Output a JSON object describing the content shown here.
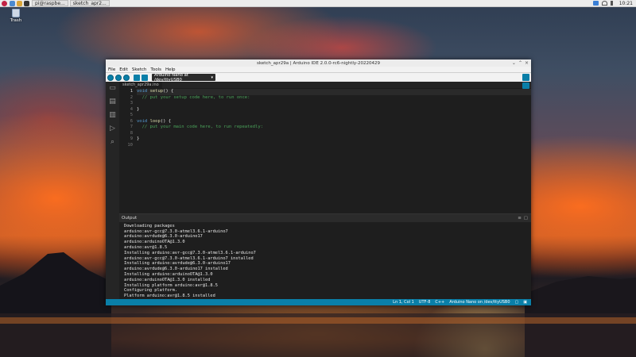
{
  "desktop": {
    "trash_label": "Trash"
  },
  "panel": {
    "tasks": [
      "pi@raspbe...",
      "sketch_apr2..."
    ],
    "clock": "10:21"
  },
  "window": {
    "title": "sketch_apr29a | Arduino IDE 2.0.0-rc6-nightly-20220429",
    "controls": [
      "⌄",
      "⌃",
      "×"
    ]
  },
  "menu": {
    "items": [
      "File",
      "Edit",
      "Sketch",
      "Tools",
      "Help"
    ]
  },
  "toolbar": {
    "board_label": "Arduino Nano at /dev/ttyUSB0"
  },
  "editor": {
    "file_tab": "sketch_apr29a.ino",
    "line_numbers": [
      "1",
      "2",
      "3",
      "4",
      "5",
      "6",
      "7",
      "8",
      "9",
      "10"
    ],
    "code": {
      "l1_kw": "void",
      "l1_fn": "setup",
      "l1_rest": "() {",
      "l2": "  // put your setup code here, to run once:",
      "l4": "}",
      "l6_kw": "void",
      "l6_fn": "loop",
      "l6_rest": "() {",
      "l7": "  // put your main code here, to run repeatedly:",
      "l9": "}"
    }
  },
  "output": {
    "title": "Output",
    "lines": [
      "Downloading packages",
      "arduino:avr-gcc@7.3.0-atmel3.6.1-arduino7",
      "arduino:avrdude@6.3.0-arduino17",
      "arduino:arduinoOTA@1.3.0",
      "arduino:avr@1.8.5",
      "Installing arduino:avr-gcc@7.3.0-atmel3.6.1-arduino7",
      "arduino:avr-gcc@7.3.0-atmel3.6.1-arduino7 installed",
      "Installing arduino:avrdude@6.3.0-arduino17",
      "arduino:avrdude@6.3.0-arduino17 installed",
      "Installing arduino:arduinoOTA@1.3.0",
      "arduino:arduinoOTA@1.3.0 installed",
      "Installing platform arduino:avr@1.8.5",
      "Configuring platform.",
      "Platform arduino:avr@1.8.5 installed"
    ]
  },
  "status": {
    "position": "Ln 1, Col 1",
    "encoding": "UTF-8",
    "language": "C++",
    "board": "Arduino Nano on /dev/ttyUSB0"
  },
  "colors": {
    "accent": "#0a7fa8",
    "editor_bg": "#1e1e1e",
    "comment": "#4aa35a",
    "keyword": "#569cd6"
  }
}
